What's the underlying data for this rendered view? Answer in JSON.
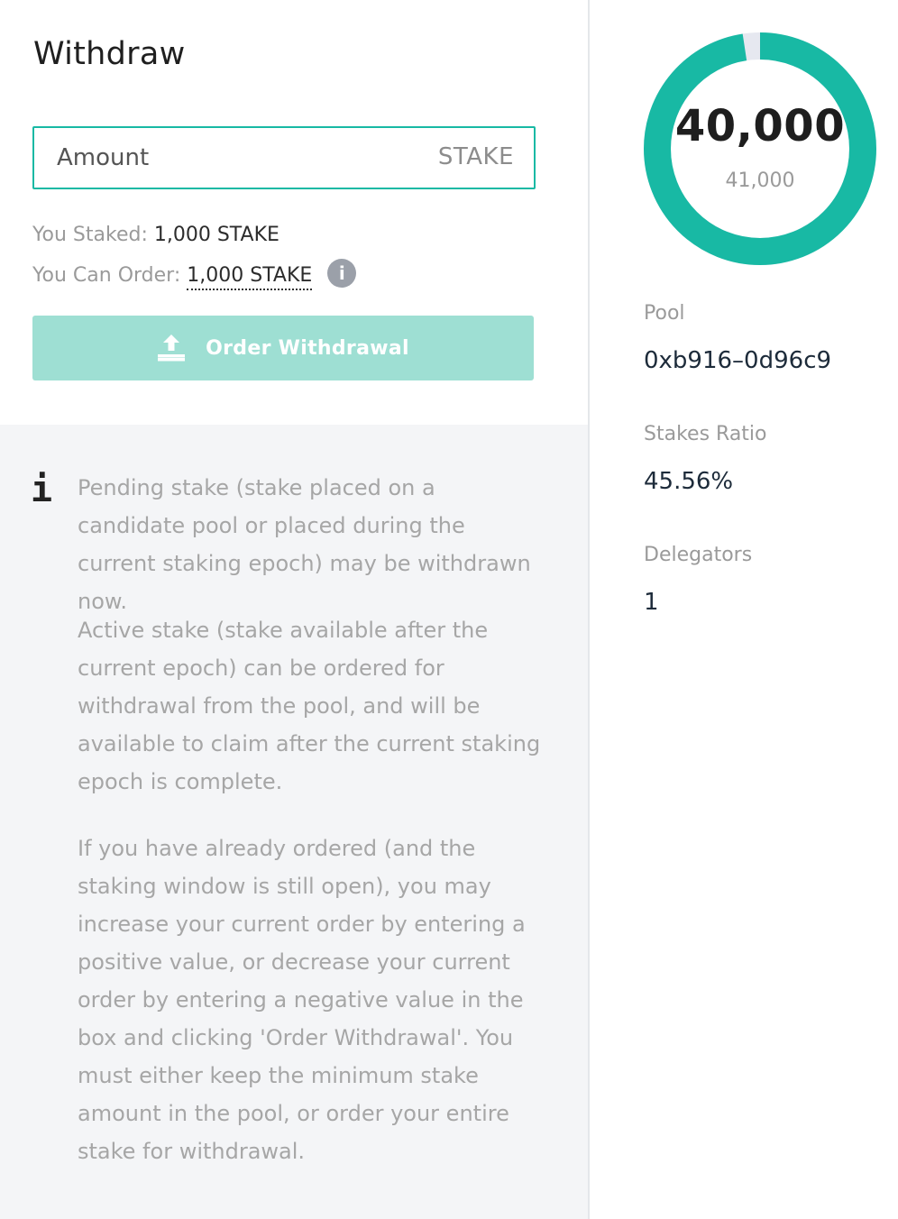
{
  "withdraw": {
    "title": "Withdraw",
    "amount_placeholder": "Amount",
    "amount_unit": "STAKE",
    "staked_label": "You Staked:",
    "staked_value": "1,000 STAKE",
    "can_order_label": "You Can Order:",
    "can_order_value": "1,000 STAKE",
    "info_badge": "i",
    "order_button_label": "Order Withdrawal"
  },
  "info": {
    "icon_glyph": "i",
    "paragraphs": [
      "Pending stake (stake placed on a candidate pool or placed during the current staking epoch) may be withdrawn now.",
      "Active stake (stake available after the current epoch) can be ordered for withdrawal from the pool, and will be available to claim after the current staking epoch is complete.",
      "If you have already ordered (and the staking window is still open), you may increase your current order by entering a positive value, or decrease your current order by entering a negative value in the box and clicking 'Order Withdrawal'. You must either keep the minimum stake amount in the pool, or order your entire stake for withdrawal."
    ]
  },
  "stats": {
    "donut_value": "40,000",
    "donut_total": "41,000",
    "donut_fill_fraction": 0.9756,
    "pool_label": "Pool",
    "pool_value": "0xb916–0d96c9",
    "ratio_label": "Stakes Ratio",
    "ratio_value": "45.56%",
    "delegators_label": "Delegators",
    "delegators_value": "1"
  },
  "colors": {
    "accent": "#18b9a4",
    "button_disabled": "#9edfd3",
    "donut_track": "#e6e8f0",
    "info_background": "#f4f5f7"
  }
}
